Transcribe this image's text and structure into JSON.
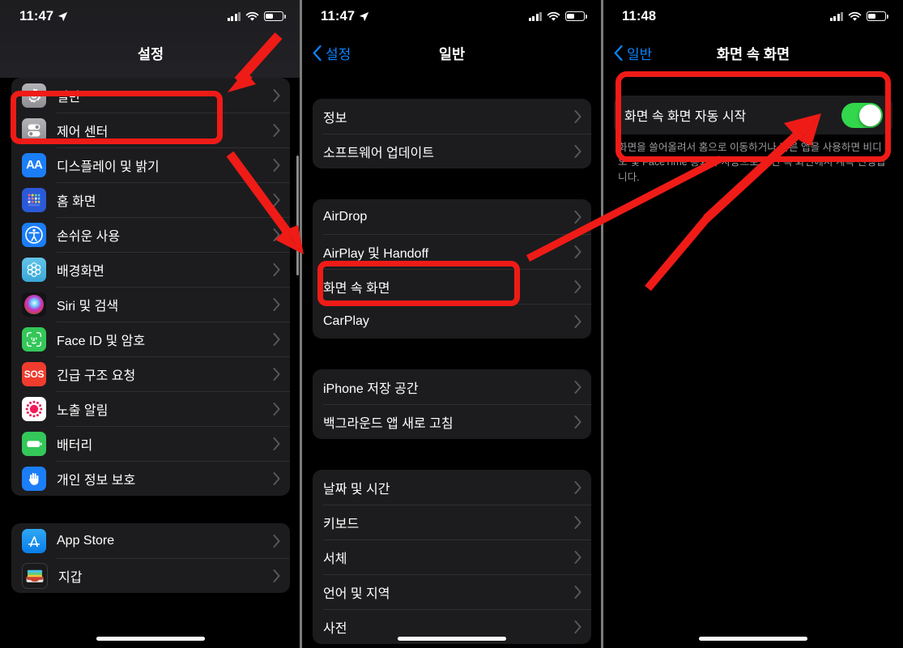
{
  "panels": [
    {
      "status": {
        "time": "11:47",
        "location_icon": "location-arrow-icon",
        "signal_icon": "cellular-signal-icon",
        "wifi_icon": "wifi-icon",
        "battery_icon": "battery-icon"
      },
      "nav": {
        "title": "설정",
        "back_label": null
      },
      "groups": [
        {
          "rows": [
            {
              "label": "일반",
              "icon": "settings-gear-icon"
            },
            {
              "label": "제어 센터",
              "icon": "control-center-icon"
            },
            {
              "label": "디스플레이 및 밝기",
              "icon": "display-brightness-icon"
            },
            {
              "label": "홈 화면",
              "icon": "home-screen-icon"
            },
            {
              "label": "손쉬운 사용",
              "icon": "accessibility-icon"
            },
            {
              "label": "배경화면",
              "icon": "wallpaper-icon"
            },
            {
              "label": "Siri 및 검색",
              "icon": "siri-icon"
            },
            {
              "label": "Face ID 및 암호",
              "icon": "face-id-icon"
            },
            {
              "label": "긴급 구조 요청",
              "icon": "sos-icon"
            },
            {
              "label": "노출 알림",
              "icon": "exposure-notification-icon"
            },
            {
              "label": "배터리",
              "icon": "battery-settings-icon"
            },
            {
              "label": "개인 정보 보호",
              "icon": "privacy-hand-icon"
            }
          ]
        },
        {
          "rows": [
            {
              "label": "App Store",
              "icon": "app-store-icon"
            },
            {
              "label": "지갑",
              "icon": "wallet-icon"
            }
          ]
        }
      ]
    },
    {
      "status": {
        "time": "11:47",
        "location_icon": "location-arrow-icon",
        "signal_icon": "cellular-signal-icon",
        "wifi_icon": "wifi-icon",
        "battery_icon": "battery-icon"
      },
      "nav": {
        "title": "일반",
        "back_label": "설정"
      },
      "groups": [
        {
          "rows": [
            {
              "label": "정보"
            },
            {
              "label": "소프트웨어 업데이트"
            }
          ]
        },
        {
          "rows": [
            {
              "label": "AirDrop"
            },
            {
              "label": "AirPlay 및 Handoff"
            },
            {
              "label": "화면 속 화면"
            },
            {
              "label": "CarPlay"
            }
          ]
        },
        {
          "rows": [
            {
              "label": "iPhone 저장 공간"
            },
            {
              "label": "백그라운드 앱 새로 고침"
            }
          ]
        },
        {
          "rows": [
            {
              "label": "날짜 및 시간"
            },
            {
              "label": "키보드"
            },
            {
              "label": "서체"
            },
            {
              "label": "언어 및 지역"
            },
            {
              "label": "사전"
            }
          ]
        }
      ]
    },
    {
      "status": {
        "time": "11:48",
        "location_icon": null,
        "signal_icon": "cellular-signal-icon",
        "wifi_icon": "wifi-icon",
        "battery_icon": "battery-icon"
      },
      "nav": {
        "title": "화면 속 화면",
        "back_label": "일반"
      },
      "toggle": {
        "label": "화면 속 화면 자동 시작",
        "state": "on",
        "footnote": "화면을 쓸어올려서 홈으로 이동하거나 다른 앱을 사용하면 비디오 및 FaceTime 통화가 자동으로 화면 속 화면에서 계속 진행됩니다."
      }
    }
  ],
  "annotations": {
    "color": "#ef1b17",
    "highlight_boxes": [
      {
        "name": "highlight-general-row",
        "target": "일반"
      },
      {
        "name": "highlight-pip-row",
        "target": "화면 속 화면"
      },
      {
        "name": "highlight-pip-auto-start-section",
        "target": "화면 속 화면 자동 시작"
      }
    ],
    "arrows": [
      {
        "name": "arrow-to-general-row"
      },
      {
        "name": "arrow-from-general-to-scroll"
      },
      {
        "name": "arrow-pip-row-to-toggle"
      }
    ]
  }
}
